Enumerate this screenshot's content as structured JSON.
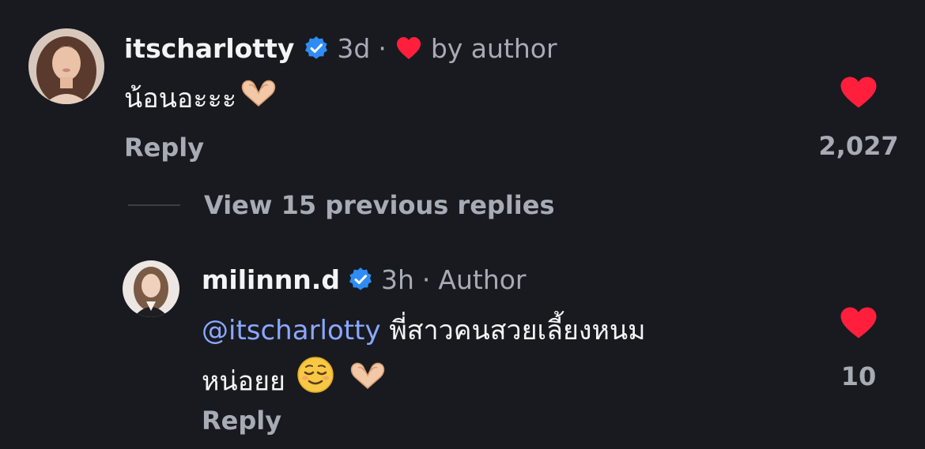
{
  "comment1": {
    "username": "itscharlotty",
    "time": "3d",
    "separator": "·",
    "liked_by_label": "by author",
    "text": "น้อนอะะะ",
    "reply_label": "Reply",
    "like_count": "2,027",
    "icons": [
      "avatar",
      "verified-badge-icon",
      "small-heart-icon",
      "heart-hands-emoji",
      "like-heart-icon"
    ]
  },
  "view_replies": {
    "label": "View 15 previous replies"
  },
  "comment2": {
    "username": "milinnn.d",
    "time": "3h",
    "separator": "·",
    "author_label": "Author",
    "mention": "@itscharlotty",
    "text_line1": "พี่สาวคนสวยเลี้ยงหนม",
    "text_line2": "หน่อยย",
    "reply_label": "Reply",
    "like_count": "10",
    "icons": [
      "avatar",
      "verified-badge-icon",
      "relieved-face-emoji",
      "heart-hands-emoji",
      "like-heart-icon"
    ]
  },
  "colors": {
    "background": "#181a1f",
    "text": "#f3f4f6",
    "muted": "#a7abb3",
    "mention": "#8ba7ff",
    "verified": "#2f8cf4",
    "heart": "#ff1f3d"
  }
}
